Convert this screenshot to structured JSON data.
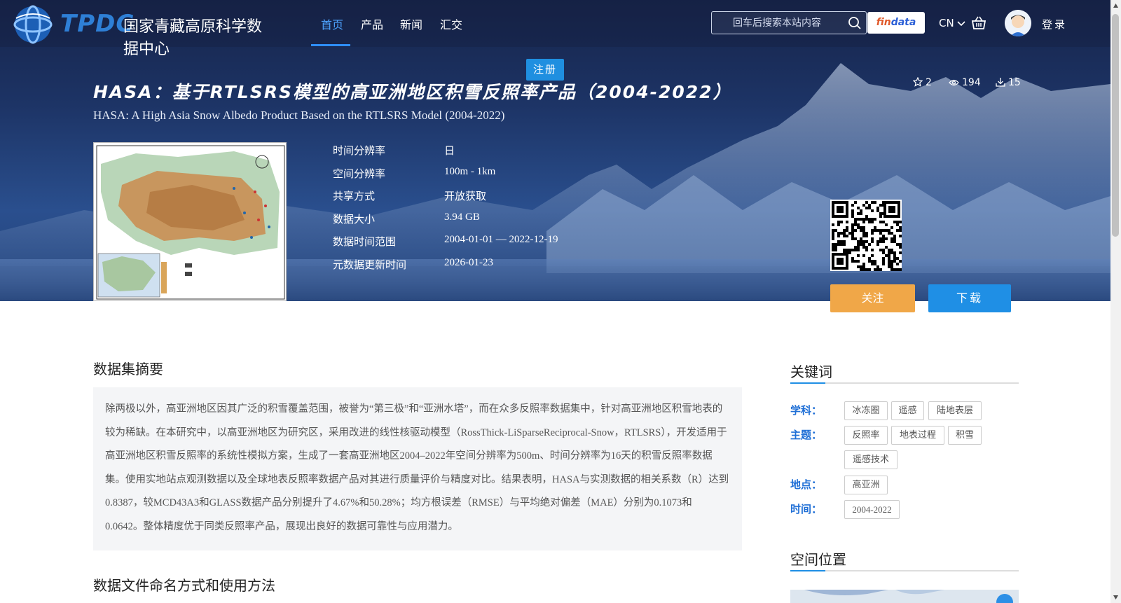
{
  "header": {
    "logo_abbr": "TPDC",
    "logo_name": "国家青藏高原科学数据中心",
    "nav": [
      {
        "label": "首页",
        "active": true
      },
      {
        "label": "产品",
        "active": false
      },
      {
        "label": "新闻",
        "active": false
      },
      {
        "label": "汇交",
        "active": false
      }
    ],
    "search_placeholder": "回车后搜索本站内容",
    "findata_left": "fin",
    "findata_right": "data",
    "lang": "CN",
    "login": "登录",
    "register": "注册"
  },
  "dataset": {
    "title": "HASA：基于RTLSRS模型的高亚洲地区积雪反照率产品（2004-2022）",
    "subtitle": "HASA: A High Asia Snow Albedo Product Based on the RTLSRS Model (2004-2022)",
    "stats": {
      "stars": "2",
      "views": "194",
      "downloads": "15"
    },
    "info": [
      {
        "label": "时间分辨率",
        "value": "日"
      },
      {
        "label": "空间分辨率",
        "value": "100m - 1km"
      },
      {
        "label": "共享方式",
        "value": "开放获取"
      },
      {
        "label": "数据大小",
        "value": "3.94 GB"
      },
      {
        "label": "数据时间范围",
        "value": "2004-01-01 — 2022-12-19"
      },
      {
        "label": "元数据更新时间",
        "value": "2026-01-23"
      }
    ],
    "follow_button": "关注",
    "download_button": "下载"
  },
  "abstract": {
    "heading": "数据集摘要",
    "text": "除两极以外，高亚洲地区因其广泛的积雪覆盖范围，被誉为“第三极”和“亚洲水塔”，而在众多反照率数据集中，针对高亚洲地区积雪地表的较为稀缺。在本研究中，以高亚洲地区为研究区，采用改进的线性核驱动模型（RossThick-LiSparseReciprocal-Snow，RTLSRS），开发适用于高亚洲地区积雪反照率的系统性模拟方案，生成了一套高亚洲地区2004–2022年空间分辨率为500m、时间分辨率为16天的积雪反照率数据集。使用实地站点观测数据以及全球地表反照率数据产品对其进行质量评价与精度对比。结果表明，HASA与实测数据的相关系数（R）达到0.8387，较MCD43A3和GLASS数据产品分别提升了4.67%和50.28%；均方根误差（RMSE）与平均绝对偏差（MAE）分别为0.1073和0.0642。整体精度优于同类反照率产品，展现出良好的数据可靠性与应用潜力。"
  },
  "file_naming": {
    "heading": "数据文件命名方式和使用方法"
  },
  "keywords": {
    "heading": "关键词",
    "groups": [
      {
        "label": "学科：",
        "tags": [
          "冰冻圈",
          "遥感",
          "陆地表层"
        ]
      },
      {
        "label": "主题：",
        "tags": [
          "反照率",
          "地表过程",
          "积雪",
          "遥感技术"
        ]
      },
      {
        "label": "地点：",
        "tags": [
          "高亚洲"
        ]
      },
      {
        "label": "时间：",
        "tags": [
          "2004-2022"
        ]
      }
    ]
  },
  "spatial": {
    "heading": "空间位置"
  },
  "colors": {
    "accent": "#1f8fe5",
    "follow": "#f0a748",
    "hero": "#1d3466"
  }
}
